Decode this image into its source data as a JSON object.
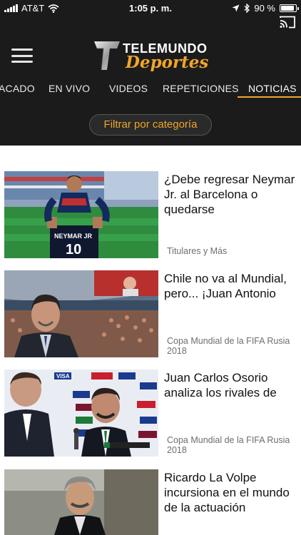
{
  "status_bar": {
    "carrier": "AT&T",
    "time": "1:05 p. m.",
    "battery": "90 %",
    "battery_level": 0.9
  },
  "header": {
    "logo_brand": "TELEMUNDO",
    "logo_sub": "Deportes",
    "tabs": [
      "ACADO",
      "EN VIVO",
      "VIDEOS",
      "REPETICIONES",
      "NOTICIAS"
    ],
    "active_tab": "NOTICIAS",
    "filter_label": "Filtrar por categoría"
  },
  "colors": {
    "accent": "#f0a62a",
    "header_bg": "#1b1b1b"
  },
  "articles": [
    {
      "title": "¿Debe regresar Neymar Jr. al Barcelona o quedarse",
      "category": "Titulares y Más",
      "jersey_text": "NEYMAR JR",
      "jersey_number": "10"
    },
    {
      "title": "Chile no va al Mundial, pero... ¡Juan Antonio",
      "category": "Copa Mundial de la FIFA Rusia 2018"
    },
    {
      "title": "Juan Carlos Osorio analiza los rivales de",
      "category": "Copa Mundial de la FIFA Rusia 2018",
      "board_text": "VISA"
    },
    {
      "title": "Ricardo La Volpe incursiona en el mundo de la actuación",
      "category": ""
    }
  ]
}
